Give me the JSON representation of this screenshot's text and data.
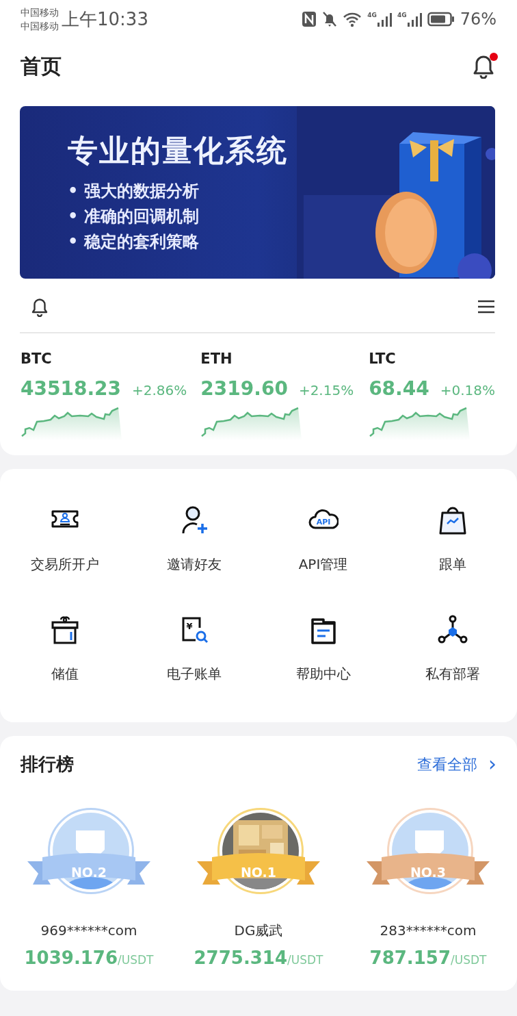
{
  "status_bar": {
    "carrier_lines": [
      "中国移动",
      "中国移动"
    ],
    "time": "上午10:33",
    "network_labels": [
      "4G",
      "4G"
    ],
    "battery": "76%"
  },
  "header": {
    "title": "首页",
    "notification_badge": true
  },
  "banner": {
    "headline": "专业的量化系统",
    "bullets": [
      "• 强大的数据分析",
      "• 准确的回调机制",
      "• 稳定的套利策略"
    ]
  },
  "tickers": [
    {
      "symbol": "BTC",
      "price": "43518.23",
      "change": "+2.86%"
    },
    {
      "symbol": "ETH",
      "price": "2319.60",
      "change": "+2.15%"
    },
    {
      "symbol": "LTC",
      "price": "68.44",
      "change": "+0.18%"
    }
  ],
  "shortcuts": [
    {
      "label": "交易所开户"
    },
    {
      "label": "邀请好友"
    },
    {
      "label": "API管理",
      "icon_text": "API"
    },
    {
      "label": "跟单"
    },
    {
      "label": "储值"
    },
    {
      "label": "电子账单",
      "icon_text": "¥"
    },
    {
      "label": "帮助中心"
    },
    {
      "label": "私有部署"
    }
  ],
  "ranking": {
    "title": "排行榜",
    "view_all": "查看全部",
    "view_all_arrow": "›",
    "entries": [
      {
        "rank": "NO.2",
        "kind": "avatar",
        "name": "969******com",
        "amount": "1039.176",
        "unit": "/USDT"
      },
      {
        "rank": "NO.1",
        "kind": "picture",
        "name": "DG威武",
        "amount": "2775.314",
        "unit": "/USDT"
      },
      {
        "rank": "NO.3",
        "kind": "avatar",
        "name": "283******com",
        "amount": "787.157",
        "unit": "/USDT"
      }
    ]
  }
}
